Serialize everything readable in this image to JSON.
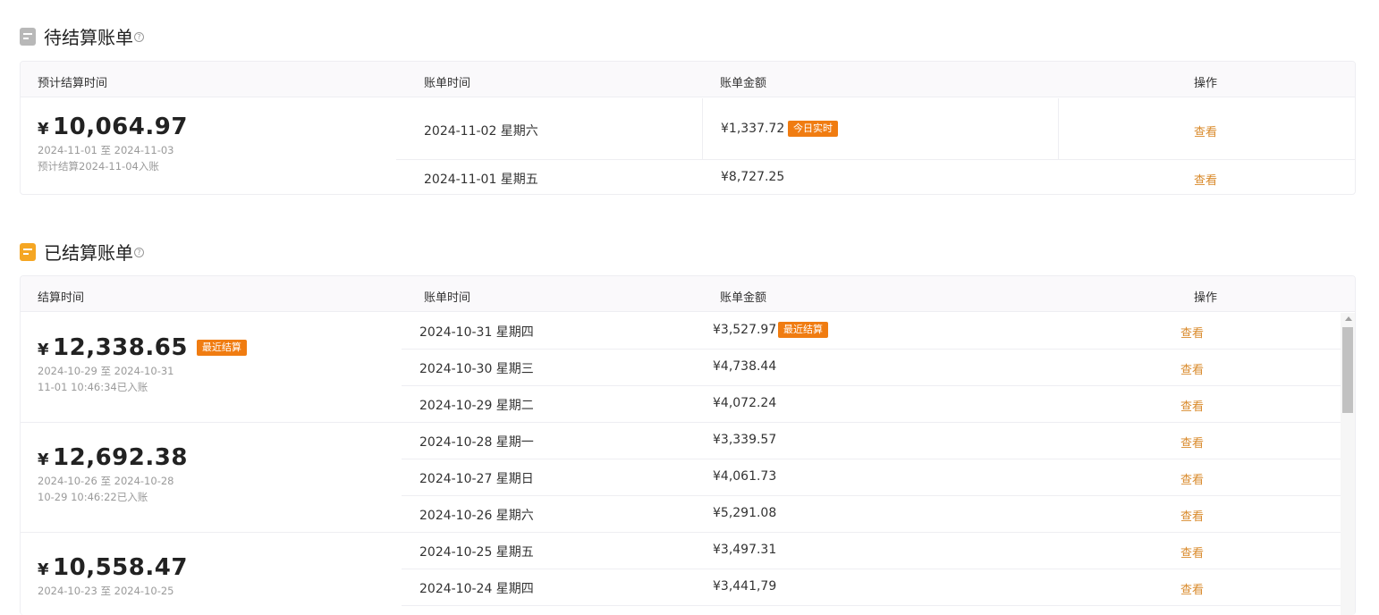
{
  "pending": {
    "title": "待结算账单",
    "help": "?",
    "headers": {
      "col1": "预计结算时间",
      "col2": "账单时间",
      "col3": "账单金额",
      "col4": "操作"
    },
    "summary": {
      "yen": "¥",
      "amount": "10,064.97",
      "range": "2024-11-01 至 2024-11-03",
      "note": "预计结算2024-11-04入账"
    },
    "rows": [
      {
        "date": "2024-11-02 星期六",
        "amount": "¥1,337.72",
        "tag": "今日实时",
        "action": "查看"
      },
      {
        "date": "2024-11-01 星期五",
        "amount": "¥8,727.25",
        "action": "查看"
      }
    ]
  },
  "settled": {
    "title": "已结算账单",
    "help": "?",
    "headers": {
      "col1": "结算时间",
      "col2": "账单时间",
      "col3": "账单金额",
      "col4": "操作"
    },
    "groups": [
      {
        "yen": "¥",
        "amount": "12,338.65",
        "tag": "最近结算",
        "range": "2024-10-29 至 2024-10-31",
        "note": "11-01 10:46:34已入账",
        "rows": [
          {
            "date": "2024-10-31 星期四",
            "amount": "¥3,527.97",
            "tag": "最近结算",
            "action": "查看"
          },
          {
            "date": "2024-10-30 星期三",
            "amount": "¥4,738.44",
            "action": "查看"
          },
          {
            "date": "2024-10-29 星期二",
            "amount": "¥4,072.24",
            "action": "查看"
          }
        ]
      },
      {
        "yen": "¥",
        "amount": "12,692.38",
        "range": "2024-10-26 至 2024-10-28",
        "note": "10-29 10:46:22已入账",
        "rows": [
          {
            "date": "2024-10-28 星期一",
            "amount": "¥3,339.57",
            "action": "查看"
          },
          {
            "date": "2024-10-27 星期日",
            "amount": "¥4,061.73",
            "action": "查看"
          },
          {
            "date": "2024-10-26 星期六",
            "amount": "¥5,291.08",
            "action": "查看"
          }
        ]
      },
      {
        "yen": "¥",
        "amount": "10,558.47",
        "range": "2024-10-23 至 2024-10-25",
        "rows": [
          {
            "date": "2024-10-25 星期五",
            "amount": "¥3,497.31",
            "action": "查看"
          },
          {
            "date": "2024-10-24 星期四",
            "amount": "¥3,441,79",
            "action": "查看"
          }
        ]
      }
    ]
  },
  "colors": {
    "accent": "#f07c11",
    "link": "#d98a2b"
  }
}
